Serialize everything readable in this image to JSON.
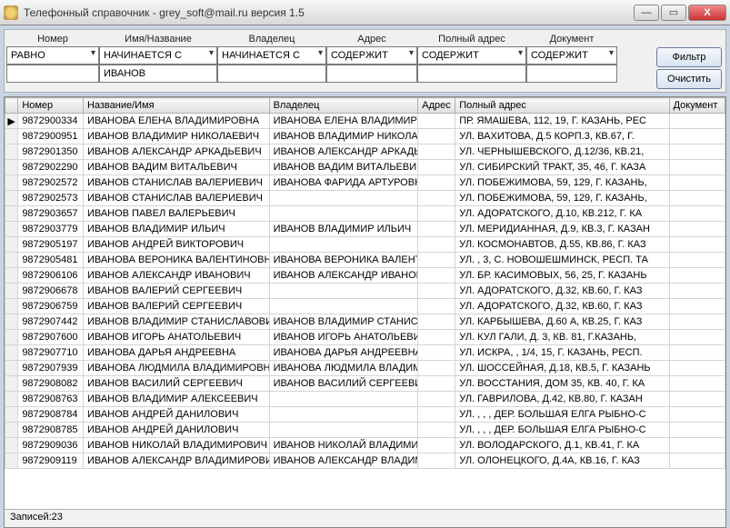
{
  "window": {
    "title": "Телефонный справочник  - grey_soft@mail.ru версия 1.5"
  },
  "filter": {
    "labels": {
      "number": "Номер",
      "name": "Имя/Название",
      "owner": "Владелец",
      "addr": "Адрес",
      "paddr": "Полный адрес",
      "doc": "Документ"
    },
    "ops": {
      "number": "РАВНО",
      "name": "НАЧИНАЕТСЯ С",
      "owner": "НАЧИНАЕТСЯ С",
      "addr": "СОДЕРЖИТ",
      "paddr": "СОДЕРЖИТ",
      "doc": "СОДЕРЖИТ"
    },
    "values": {
      "number": "",
      "name": "ИВАНОВ",
      "owner": "",
      "addr": "",
      "paddr": "",
      "doc": ""
    },
    "buttons": {
      "filter": "Фильтр",
      "clear": "Очистить"
    }
  },
  "columns": {
    "number": "Номер",
    "name": "Название/Имя",
    "owner": "Владелец",
    "addr": "Адрес",
    "paddr": "Полный адрес",
    "doc": "Документ"
  },
  "rows": [
    {
      "ptr": "▶",
      "num": "9872900334",
      "name": "ИВАНОВА ЕЛЕНА ВЛАДИМИРОВНА",
      "owner": "ИВАНОВА ЕЛЕНА ВЛАДИМИРО",
      "addr": "",
      "paddr": "ПР. ЯМАШЕВА, 112, 19, Г. КАЗАНЬ, РЕС",
      "doc": ""
    },
    {
      "ptr": "",
      "num": "9872900951",
      "name": "ИВАНОВ ВЛАДИМИР НИКОЛАЕВИЧ",
      "owner": "ИВАНОВ ВЛАДИМИР НИКОЛА",
      "addr": "",
      "paddr": "УЛ. ВАХИТОВА, Д.5 КОРП.3, КВ.67, Г.",
      "doc": ""
    },
    {
      "ptr": "",
      "num": "9872901350",
      "name": "ИВАНОВ АЛЕКСАНДР АРКАДЬЕВИЧ",
      "owner": "ИВАНОВ АЛЕКСАНДР АРКАДЬ",
      "addr": "",
      "paddr": "УЛ. ЧЕРНЫШЕВСКОГО, Д.12/36, КВ.21,",
      "doc": ""
    },
    {
      "ptr": "",
      "num": "9872902290",
      "name": "ИВАНОВ ВАДИМ ВИТАЛЬЕВИЧ",
      "owner": "ИВАНОВ ВАДИМ ВИТАЛЬЕВИЧ",
      "addr": "",
      "paddr": "УЛ. СИБИРСКИЙ ТРАКТ, 35, 46, Г. КАЗА",
      "doc": ""
    },
    {
      "ptr": "",
      "num": "9872902572",
      "name": "ИВАНОВ СТАНИСЛАВ ВАЛЕРИЕВИЧ",
      "owner": "ИВАНОВА ФАРИДА АРТУРОВН",
      "addr": "",
      "paddr": "УЛ. ПОБЕЖИМОВА, 59, 129, Г. КАЗАНЬ,",
      "doc": ""
    },
    {
      "ptr": "",
      "num": "9872902573",
      "name": "ИВАНОВ СТАНИСЛАВ ВАЛЕРИЕВИЧ",
      "owner": "",
      "addr": "",
      "paddr": "УЛ. ПОБЕЖИМОВА, 59, 129, Г. КАЗАНЬ,",
      "doc": ""
    },
    {
      "ptr": "",
      "num": "9872903657",
      "name": "ИВАНОВ ПАВЕЛ ВАЛЕРЬЕВИЧ",
      "owner": "",
      "addr": "",
      "paddr": "УЛ. АДОРАТСКОГО, Д.10, КВ.212, Г. КА",
      "doc": ""
    },
    {
      "ptr": "",
      "num": "9872903779",
      "name": "ИВАНОВ ВЛАДИМИР ИЛЬИЧ",
      "owner": "ИВАНОВ ВЛАДИМИР ИЛЬИЧ",
      "addr": "",
      "paddr": "УЛ. МЕРИДИАННАЯ, Д.9, КВ.3, Г. КАЗАН",
      "doc": ""
    },
    {
      "ptr": "",
      "num": "9872905197",
      "name": "ИВАНОВ АНДРЕЙ ВИКТОРОВИЧ",
      "owner": "",
      "addr": "",
      "paddr": "УЛ. КОСМОНАВТОВ, Д.55, КВ.86, Г. КАЗ",
      "doc": ""
    },
    {
      "ptr": "",
      "num": "9872905481",
      "name": "ИВАНОВА ВЕРОНИКА ВАЛЕНТИНОВНА",
      "owner": "ИВАНОВА ВЕРОНИКА ВАЛЕНТ",
      "addr": "",
      "paddr": "УЛ. , 3, С. НОВОШЕШМИНСК, РЕСП. ТА",
      "doc": ""
    },
    {
      "ptr": "",
      "num": "9872906106",
      "name": "ИВАНОВ АЛЕКСАНДР ИВАНОВИЧ",
      "owner": "ИВАНОВ АЛЕКСАНДР ИВАНОВ",
      "addr": "",
      "paddr": "УЛ. БР. КАСИМОВЫХ, 56, 25, Г. КАЗАНЬ",
      "doc": ""
    },
    {
      "ptr": "",
      "num": "9872906678",
      "name": "ИВАНОВ ВАЛЕРИЙ СЕРГЕЕВИЧ",
      "owner": "",
      "addr": "",
      "paddr": "УЛ. АДОРАТСКОГО, Д.32, КВ.60, Г. КАЗ",
      "doc": ""
    },
    {
      "ptr": "",
      "num": "9872906759",
      "name": "ИВАНОВ ВАЛЕРИЙ СЕРГЕЕВИЧ",
      "owner": "",
      "addr": "",
      "paddr": "УЛ. АДОРАТСКОГО, Д.32, КВ.60, Г. КАЗ",
      "doc": ""
    },
    {
      "ptr": "",
      "num": "9872907442",
      "name": "ИВАНОВ ВЛАДИМИР СТАНИСЛАВОВИЧ",
      "owner": "ИВАНОВ ВЛАДИМИР СТАНИСЛ",
      "addr": "",
      "paddr": "УЛ. КАРБЫШЕВА, Д.60 А, КВ.25, Г. КАЗ",
      "doc": ""
    },
    {
      "ptr": "",
      "num": "9872907600",
      "name": "ИВАНОВ ИГОРЬ АНАТОЛЬЕВИЧ",
      "owner": "ИВАНОВ ИГОРЬ АНАТОЛЬЕВИ",
      "addr": "",
      "paddr": "УЛ. КУЛ ГАЛИ, Д. 3, КВ. 81, Г.КАЗАНЬ,",
      "doc": ""
    },
    {
      "ptr": "",
      "num": "9872907710",
      "name": "ИВАНОВА ДАРЬЯ АНДРЕЕВНА",
      "owner": "ИВАНОВА ДАРЬЯ АНДРЕЕВНА",
      "addr": "",
      "paddr": "УЛ. ИСКРА, , 1/4, 15, Г. КАЗАНЬ, РЕСП.",
      "doc": ""
    },
    {
      "ptr": "",
      "num": "9872907939",
      "name": "ИВАНОВА ЛЮДМИЛА ВЛАДИМИРОВНА",
      "owner": "ИВАНОВА ЛЮДМИЛА ВЛАДИМ",
      "addr": "",
      "paddr": "УЛ. ШОССЕЙНАЯ, Д.18, КВ.5, Г. КАЗАНЬ",
      "doc": ""
    },
    {
      "ptr": "",
      "num": "9872908082",
      "name": "ИВАНОВ ВАСИЛИЙ СЕРГЕЕВИЧ",
      "owner": "ИВАНОВ ВАСИЛИЙ СЕРГЕЕВИЧ",
      "addr": "",
      "paddr": "УЛ. ВОССТАНИЯ, ДОМ 35, КВ. 40, Г. КА",
      "doc": ""
    },
    {
      "ptr": "",
      "num": "9872908763",
      "name": "ИВАНОВ ВЛАДИМИР АЛЕКСЕЕВИЧ",
      "owner": "",
      "addr": "",
      "paddr": "УЛ. ГАВРИЛОВА, Д.42, КВ.80, Г. КАЗАН",
      "doc": ""
    },
    {
      "ptr": "",
      "num": "9872908784",
      "name": "ИВАНОВ АНДРЕЙ ДАНИЛОВИЧ",
      "owner": "",
      "addr": "",
      "paddr": "УЛ. , , , ДЕР. БОЛЬШАЯ ЕЛГА РЫБНО-С",
      "doc": ""
    },
    {
      "ptr": "",
      "num": "9872908785",
      "name": "ИВАНОВ АНДРЕЙ ДАНИЛОВИЧ",
      "owner": "",
      "addr": "",
      "paddr": "УЛ. , , , ДЕР. БОЛЬШАЯ ЕЛГА РЫБНО-С",
      "doc": ""
    },
    {
      "ptr": "",
      "num": "9872909036",
      "name": "ИВАНОВ НИКОЛАЙ ВЛАДИМИРОВИЧ",
      "owner": "ИВАНОВ НИКОЛАЙ ВЛАДИМИР",
      "addr": "",
      "paddr": "УЛ. ВОЛОДАРСКОГО, Д.1, КВ.41, Г. КА",
      "doc": ""
    },
    {
      "ptr": "",
      "num": "9872909119",
      "name": "ИВАНОВ АЛЕКСАНДР ВЛАДИМИРОВИЧ",
      "owner": "ИВАНОВ АЛЕКСАНДР ВЛАДИМ",
      "addr": "",
      "paddr": "УЛ. ОЛОНЕЦКОГО, Д.4А, КВ.16, Г. КАЗ",
      "doc": ""
    }
  ],
  "status": {
    "count_label": "Записей:23"
  }
}
